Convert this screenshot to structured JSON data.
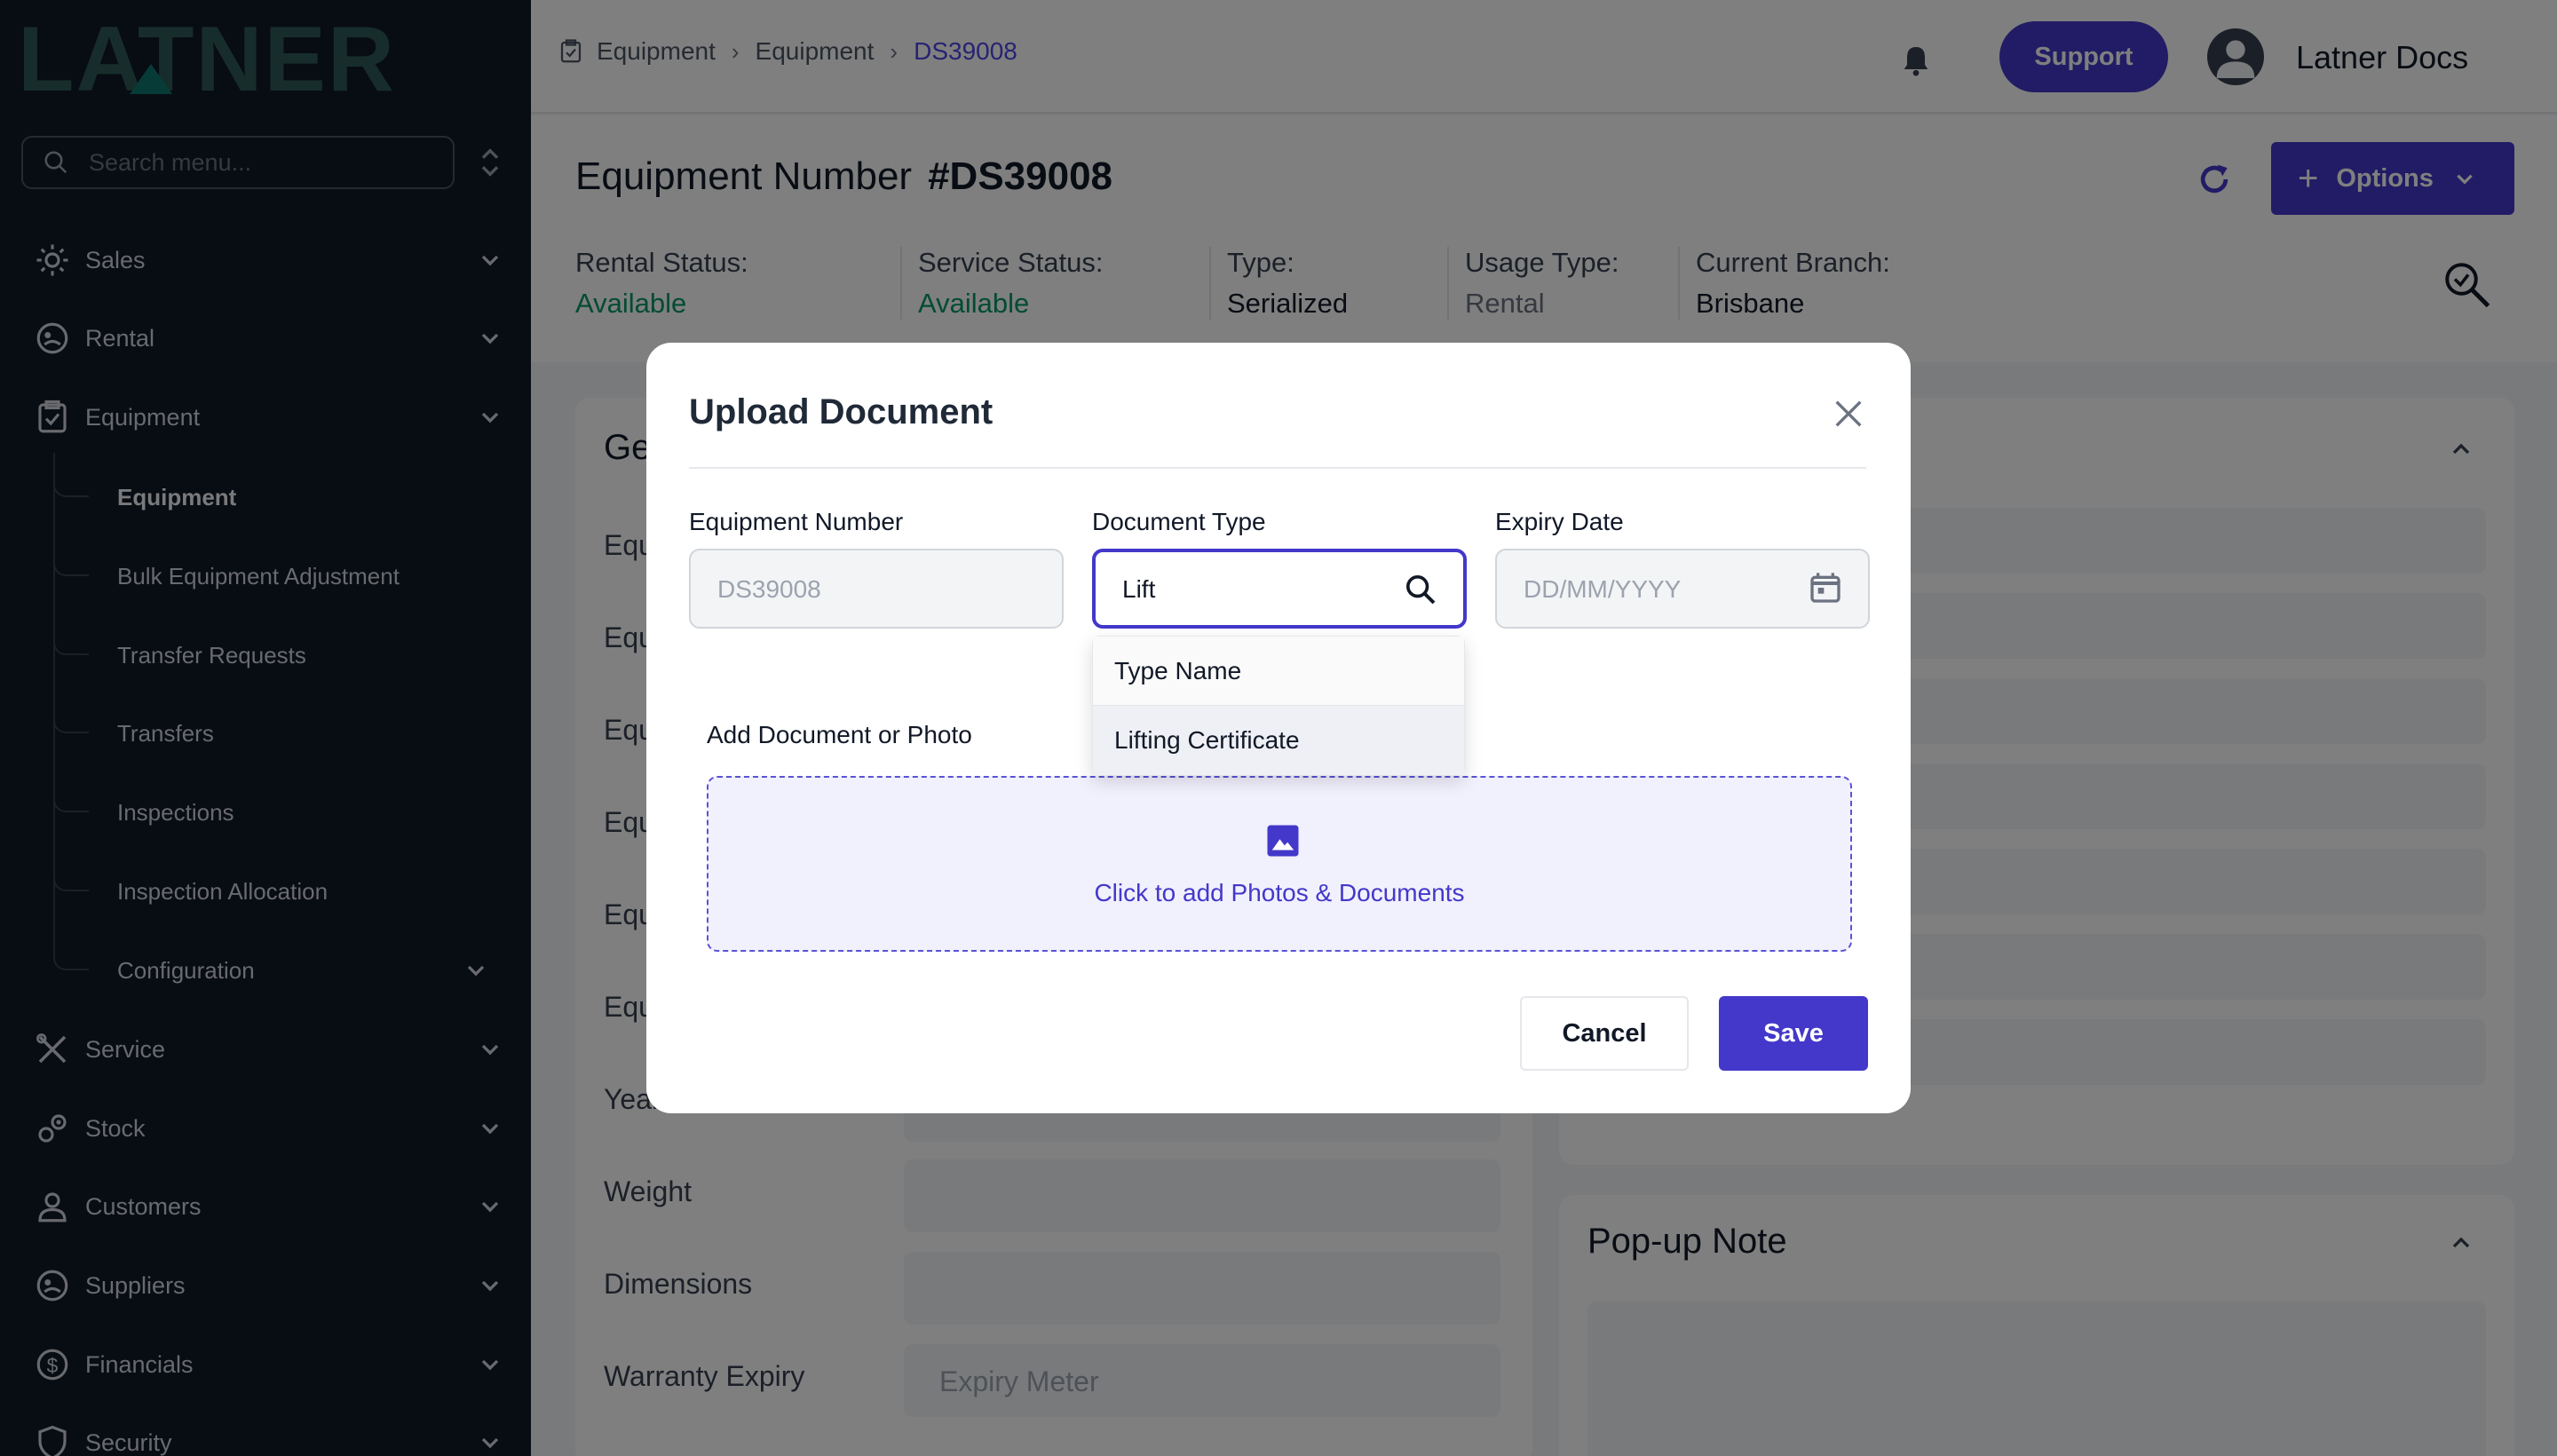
{
  "brand": {
    "logo_text": "LATNER",
    "logo_color": "#2e5b57",
    "accent_triangle": "#0f766e"
  },
  "sidebar": {
    "search_placeholder": "Search menu...",
    "items": [
      {
        "label": "Sales",
        "icon": "sales-icon"
      },
      {
        "label": "Rental",
        "icon": "rental-icon"
      },
      {
        "label": "Equipment",
        "icon": "equipment-icon"
      },
      {
        "label": "Service",
        "icon": "service-icon"
      },
      {
        "label": "Stock",
        "icon": "stock-icon"
      },
      {
        "label": "Customers",
        "icon": "customers-icon"
      },
      {
        "label": "Suppliers",
        "icon": "suppliers-icon"
      },
      {
        "label": "Financials",
        "icon": "financials-icon"
      },
      {
        "label": "Security",
        "icon": "security-icon"
      }
    ],
    "equipment_sub": [
      {
        "label": "Equipment",
        "active": true
      },
      {
        "label": "Bulk Equipment Adjustment"
      },
      {
        "label": "Transfer Requests"
      },
      {
        "label": "Transfers"
      },
      {
        "label": "Inspections"
      },
      {
        "label": "Inspection Allocation"
      },
      {
        "label": "Configuration"
      }
    ]
  },
  "topbar": {
    "breadcrumbs": [
      "Equipment",
      "Equipment",
      "DS39008"
    ],
    "support_label": "Support",
    "user_name": "Latner Docs"
  },
  "header": {
    "title_prefix": "Equipment Number",
    "title_number": "#DS39008",
    "options_label": "Options",
    "status": [
      {
        "key": "Rental Status:",
        "value": "Available",
        "style": "green"
      },
      {
        "key": "Service Status:",
        "value": "Available",
        "style": "green"
      },
      {
        "key": "Type:",
        "value": "Serialized",
        "style": "normal"
      },
      {
        "key": "Usage Type:",
        "value": "Rental",
        "style": "muted"
      },
      {
        "key": "Current Branch:",
        "value": "Brisbane",
        "style": "normal"
      }
    ]
  },
  "content": {
    "general_title": "Ge",
    "left_labels": [
      "Equ",
      "Equ",
      "Equ",
      "Equ",
      "Equ",
      "Equ",
      "Year",
      "Weight",
      "Dimensions",
      "Warranty Expiry"
    ],
    "warranty_placeholder": "Expiry Meter",
    "popup_note_title": "Pop-up Note"
  },
  "modal": {
    "title": "Upload Document",
    "equipment_number_label": "Equipment Number",
    "equipment_number_value": "DS39008",
    "document_type_label": "Document Type",
    "document_type_value": "Lift",
    "expiry_date_label": "Expiry Date",
    "expiry_date_placeholder": "DD/MM/YYYY",
    "dropdown_header": "Type Name",
    "dropdown_option": "Lifting Certificate",
    "add_doc_label": "Add Document or Photo",
    "drop_text": "Click to add Photos & Documents",
    "cancel_label": "Cancel",
    "save_label": "Save"
  },
  "colors": {
    "primary": "#4338ca",
    "sidebar_bg": "#111827",
    "green": "#059669"
  }
}
